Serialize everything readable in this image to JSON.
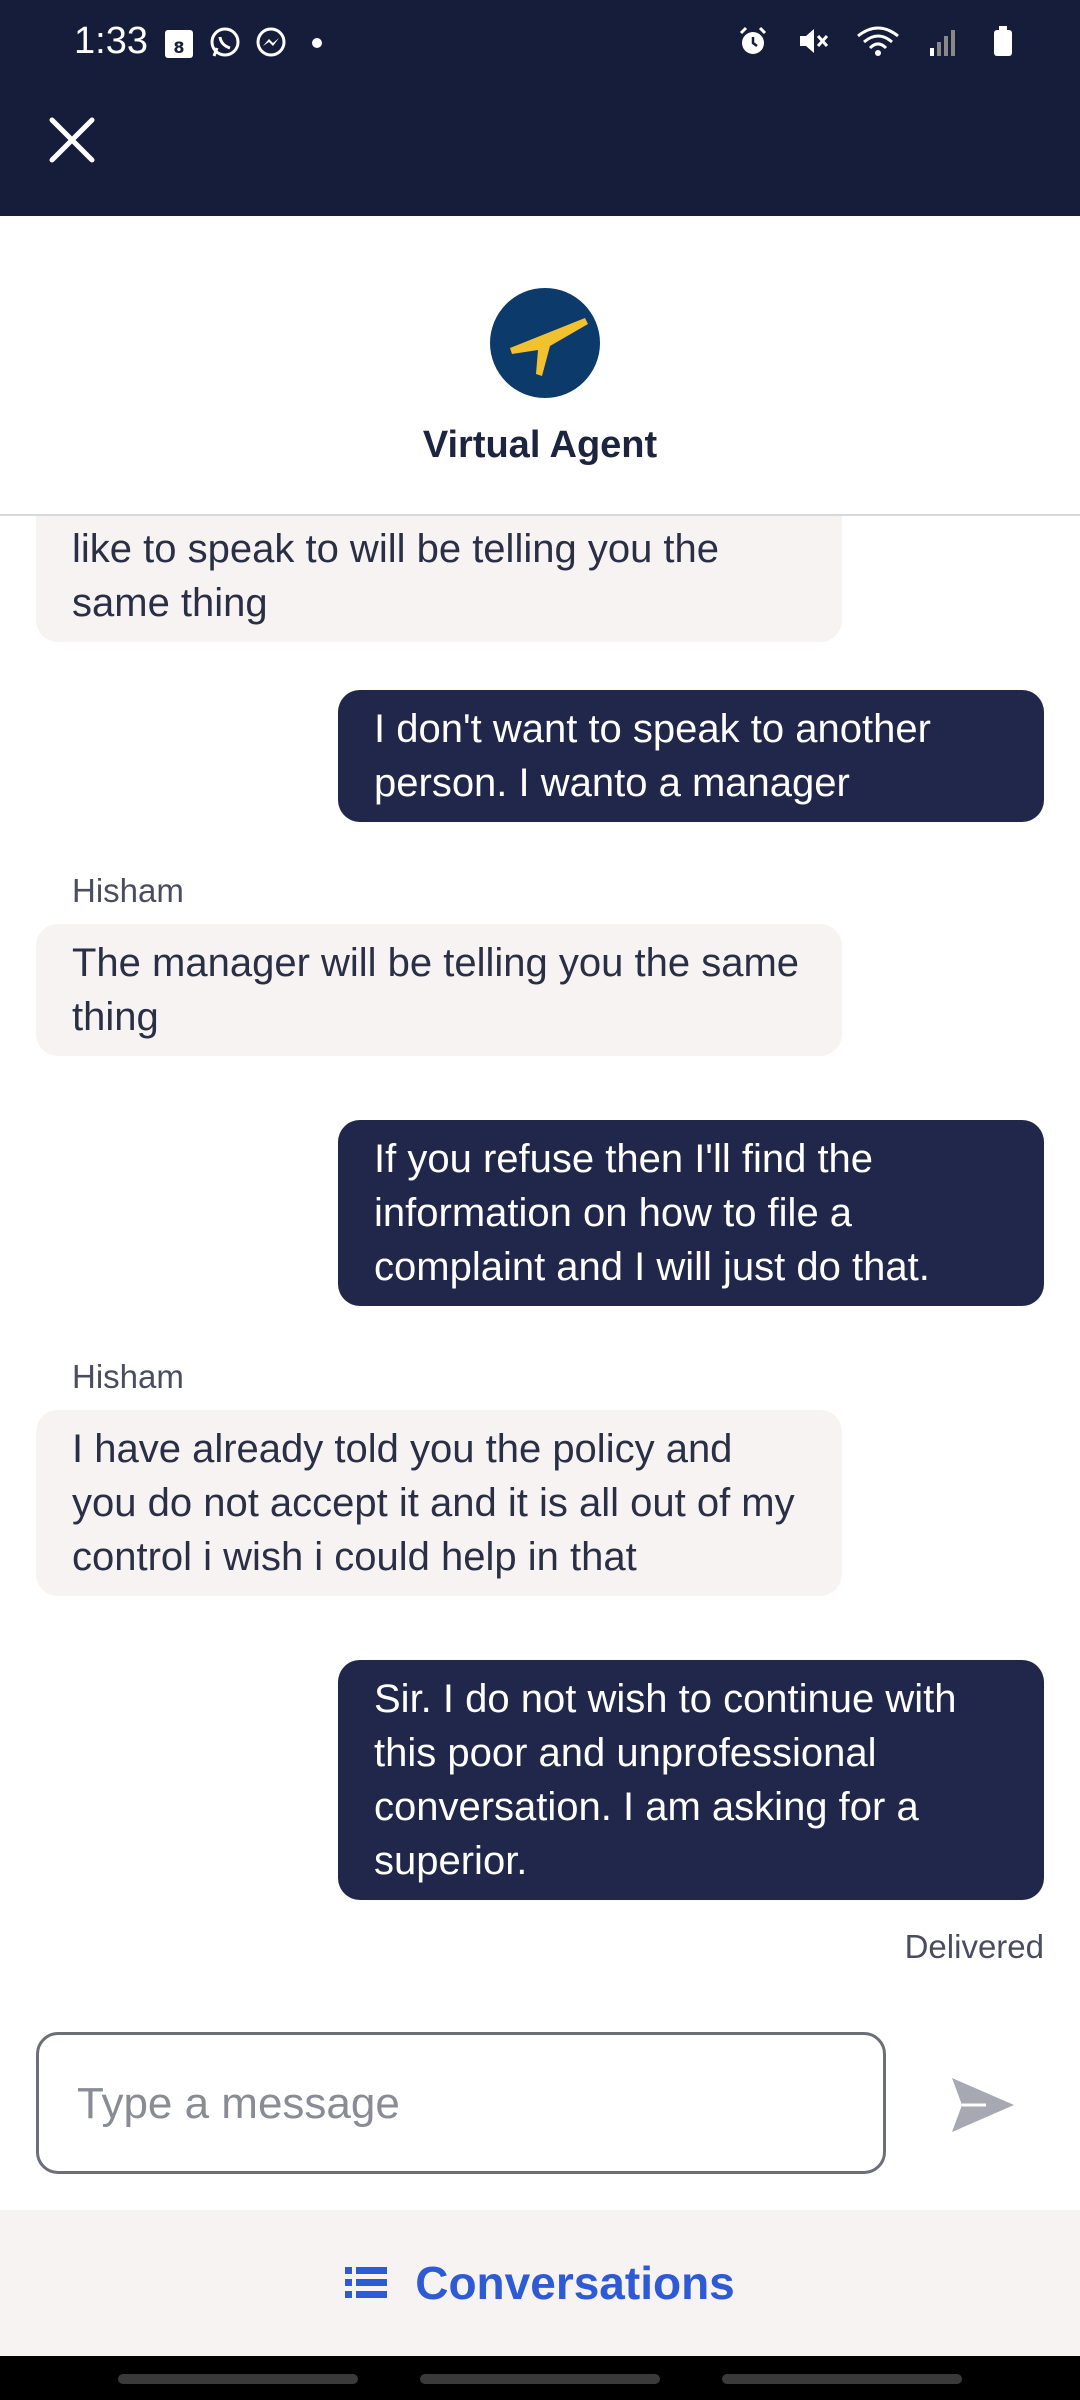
{
  "status_bar": {
    "time": "1:33",
    "calendar_badge": "8"
  },
  "header": {
    "agent_name": "Virtual Agent"
  },
  "messages": [
    {
      "from": "agent",
      "text": "like to speak to will be telling you the same thing"
    },
    {
      "from": "user",
      "text": "I don't want to speak to another person. I wanto a manager"
    },
    {
      "from": "agent",
      "sender": "Hisham",
      "text": "The manager will be telling you the same thing"
    },
    {
      "from": "user",
      "text": "If you refuse then I'll find the information on how to file a complaint and I will just do that."
    },
    {
      "from": "agent",
      "sender": "Hisham",
      "text": "I have already told you the policy and you do not accept it and it is all out of my control i wish i could help in that"
    },
    {
      "from": "user",
      "text": "Sir. I do not wish to continue with this poor and unprofessional conversation. I am asking for a superior."
    }
  ],
  "delivery_status": "Delivered",
  "composer": {
    "placeholder": "Type a message",
    "value": ""
  },
  "bottom_bar": {
    "conversations_label": "Conversations"
  },
  "colors": {
    "topbar": "#151d3a",
    "user_bubble": "#20274a",
    "agent_bubble": "#f6f3f2",
    "accent": "#2e5ad6",
    "logo_blue": "#0b3a6b",
    "logo_yellow": "#f2c12e"
  },
  "icons": {
    "close": "close-icon",
    "send": "send-icon",
    "conversations": "list-icon"
  }
}
